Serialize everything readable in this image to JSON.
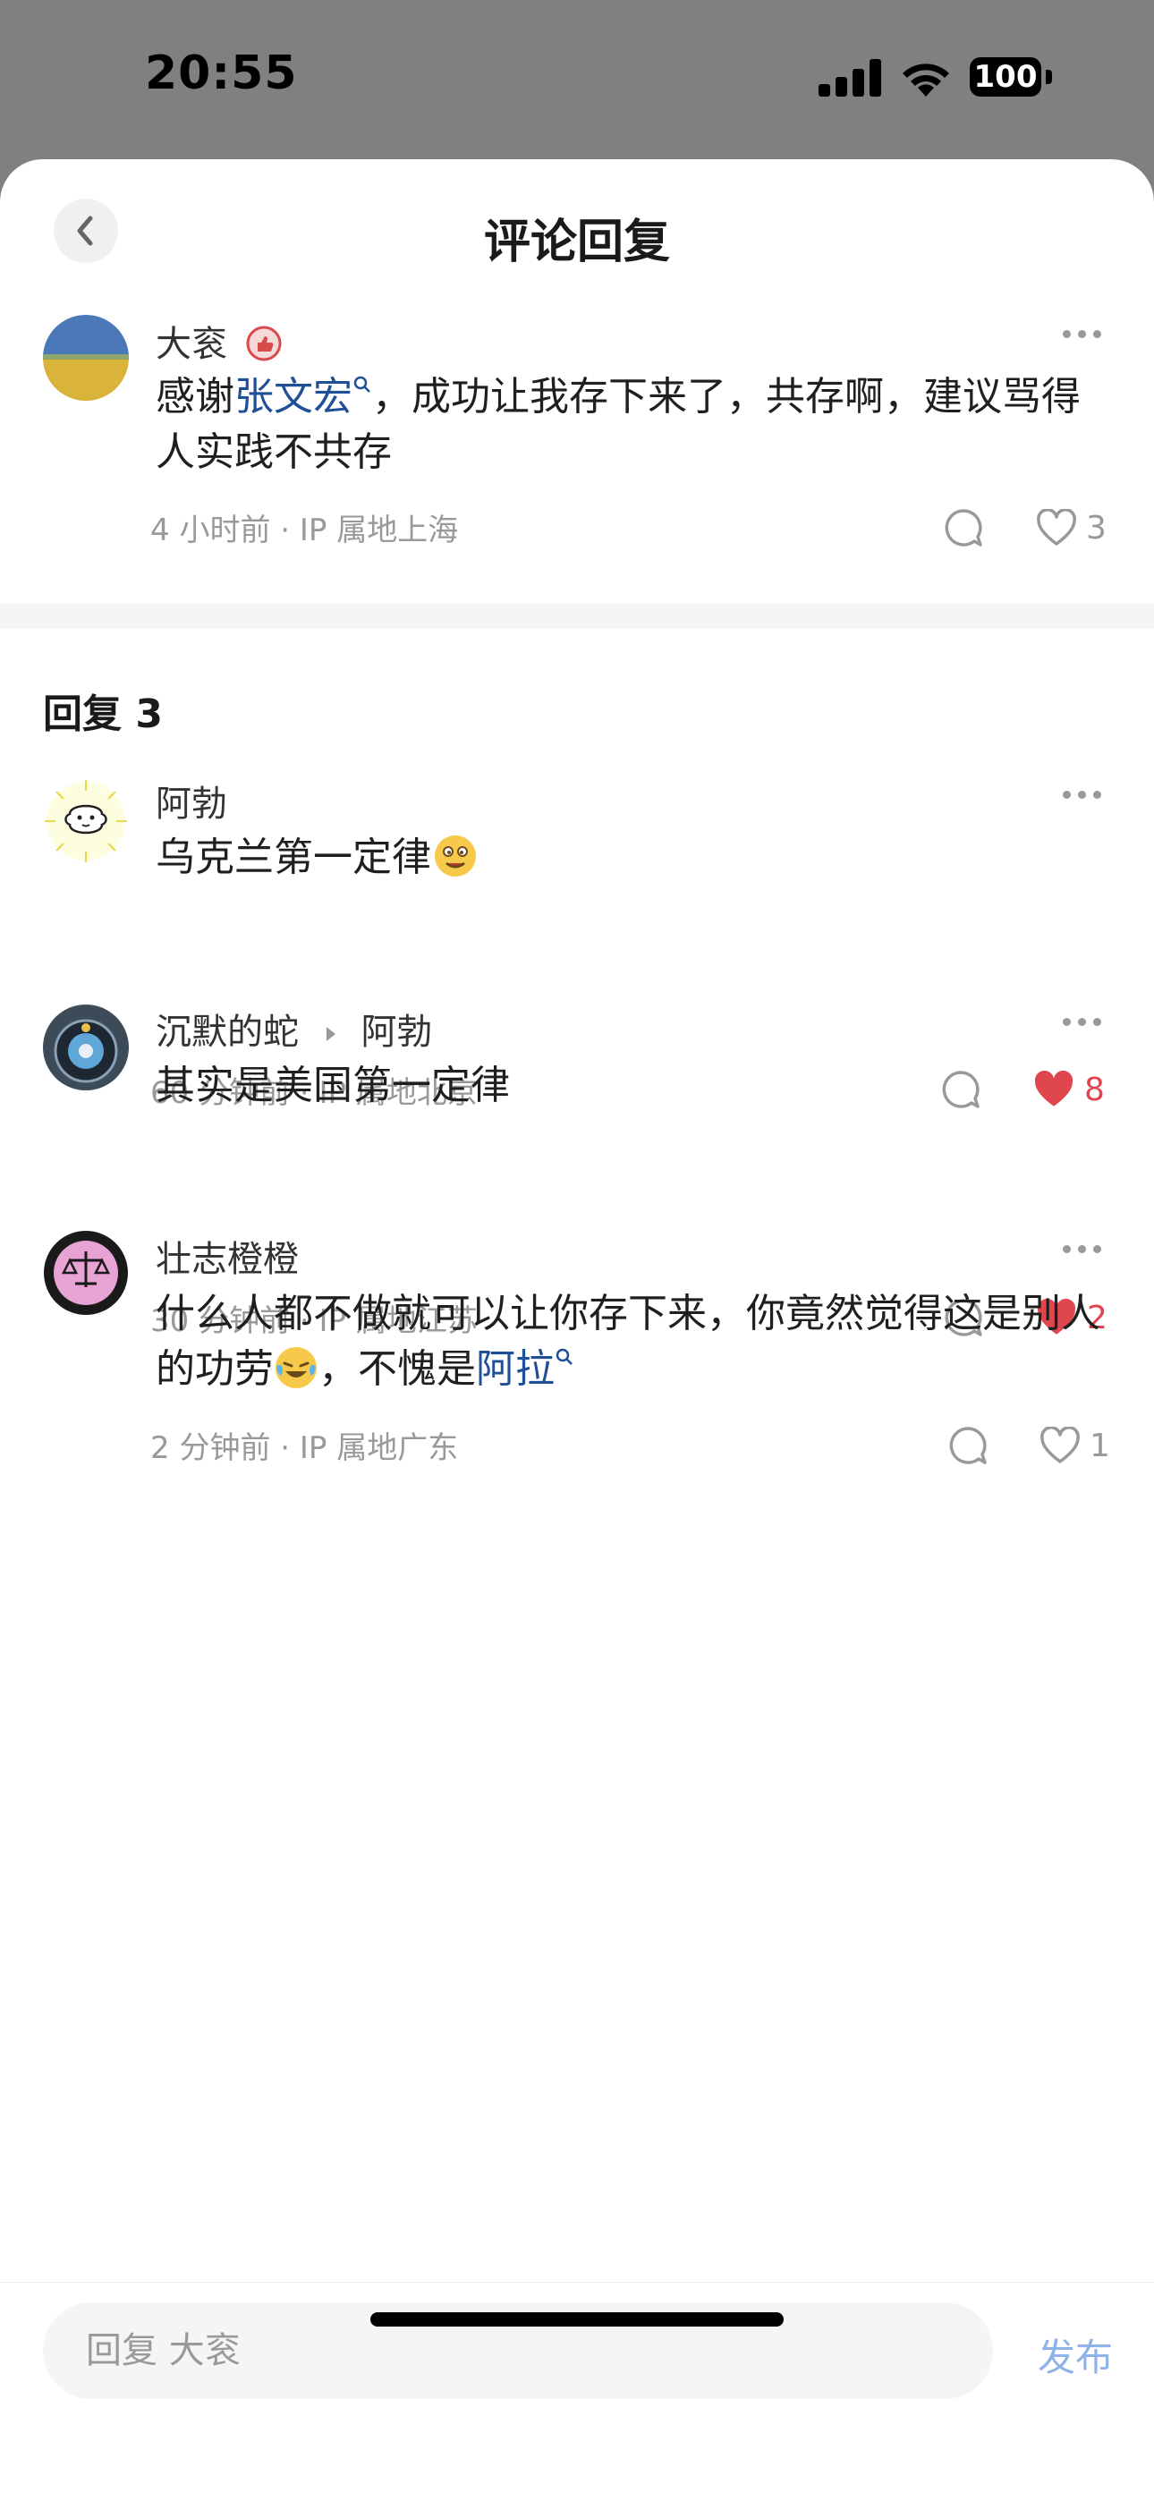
{
  "status": {
    "time": "20:55",
    "battery": "100"
  },
  "header": {
    "title": "评论回复"
  },
  "main_comment": {
    "user": "大衮",
    "text_before": "感谢",
    "mention": "张文宏",
    "text_after": "，成功让我存下来了，共存啊，建议骂得人实践不共存",
    "meta": "4 小时前 · IP 属地上海",
    "likes": "3"
  },
  "replies_header": "回复 3",
  "replies": [
    {
      "user": "阿勃",
      "text": "乌克兰第一定律",
      "meta": "60 分钟前 · IP 属地北京",
      "likes": "8"
    },
    {
      "user": "沉默的蛇",
      "reply_to": "阿勃",
      "text": "其实是美国第一定律",
      "meta": "30 分钟前 · IP 属地江苏",
      "likes": "2"
    },
    {
      "user": "壮志橙橙",
      "text_before": "什么人都不做就可以让你存下来，你竟然觉得这是别人的功劳",
      "text_mid": "，不愧是",
      "mention": "阿拉",
      "meta": "2 分钟前 · IP 属地广东",
      "likes": "1"
    }
  ],
  "bottom": {
    "placeholder": "回复 大衮",
    "publish": "发布"
  },
  "colors": {
    "link": "#1f4f96",
    "like_active": "#e0464e",
    "meta_gray": "#999999",
    "publish": "#8fb3e8"
  }
}
